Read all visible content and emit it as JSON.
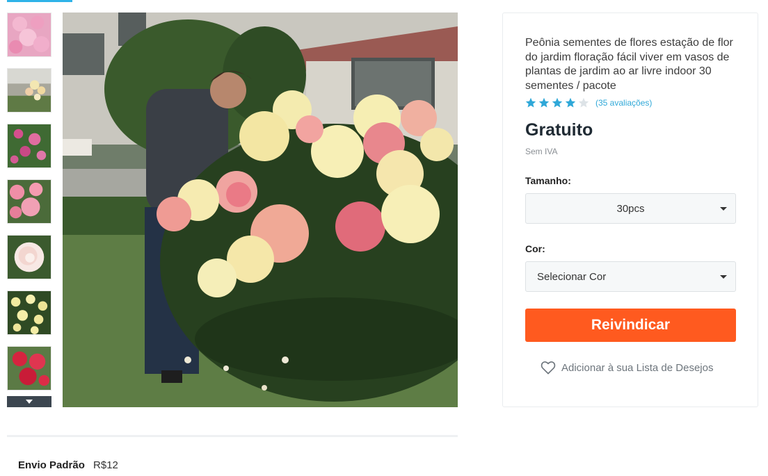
{
  "product": {
    "title": "Peônia sementes de flores estação de flor do jardim floração fácil viver em vasos de plantas de jardim ao ar livre indoor 30 sementes / pacote",
    "rating": 4,
    "rating_max": 5,
    "reviews_text": "(35 avaliações)",
    "price": "Gratuito",
    "tax_note": "Sem IVA"
  },
  "options": {
    "size_label": "Tamanho:",
    "size_value": "30pcs",
    "color_label": "Cor:",
    "color_value": "Selecionar Cor"
  },
  "actions": {
    "claim_label": "Reivindicar",
    "wishlist_label": "Adicionar à sua Lista de Desejos"
  },
  "shipping": {
    "label": "Envio Padrão",
    "price": "R$12"
  },
  "gallery": {
    "thumbnails": [
      "pink-peony-cluster",
      "cream-peony-bush",
      "pink-peony-garden",
      "pink-peony-bloom",
      "white-peony",
      "yellow-peony-bush",
      "red-peony"
    ]
  },
  "colors": {
    "accent_blue": "#2fb3e8",
    "claim_orange": "#ff5a1f",
    "star_blue": "#2fa8d8"
  }
}
